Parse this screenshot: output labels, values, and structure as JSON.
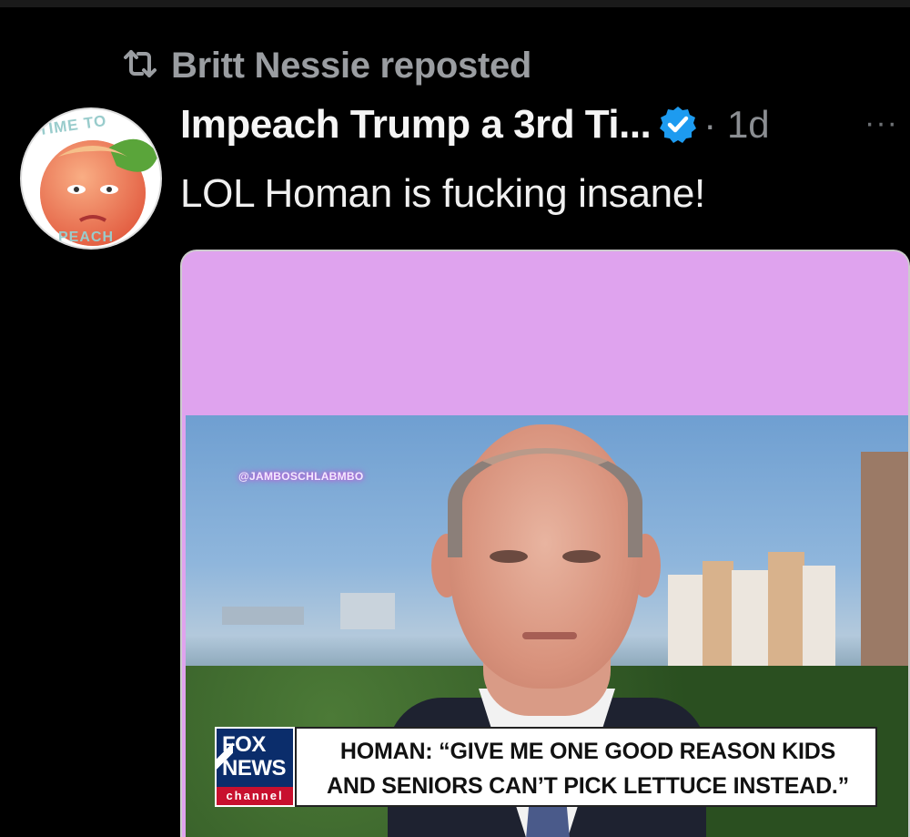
{
  "repost": {
    "icon": "repost-icon",
    "text": "Britt Nessie reposted"
  },
  "tweet": {
    "author_name": "Impeach Trump a 3rd Ti...",
    "verified_icon": "verified-badge-icon",
    "verified_color": "#1d9bf0",
    "time": "· 1d",
    "more_icon": "more-options-icon",
    "more_label": "···",
    "text": "LOL Homan is fucking insane!",
    "avatar": {
      "text_top": "TIME TO",
      "text_bottom": "PEACH"
    }
  },
  "media": {
    "background_color": "#dfa3ee",
    "watermark": "@JAMBOSCHLABMBO",
    "logo": {
      "line1": "FOX",
      "line2": "NEWS",
      "line3": "channel"
    },
    "chyron": {
      "line1": "HOMAN: “GIVE ME ONE GOOD REASON KIDS",
      "line2": "AND SENIORS CAN’T PICK LETTUCE INSTEAD.”"
    }
  }
}
